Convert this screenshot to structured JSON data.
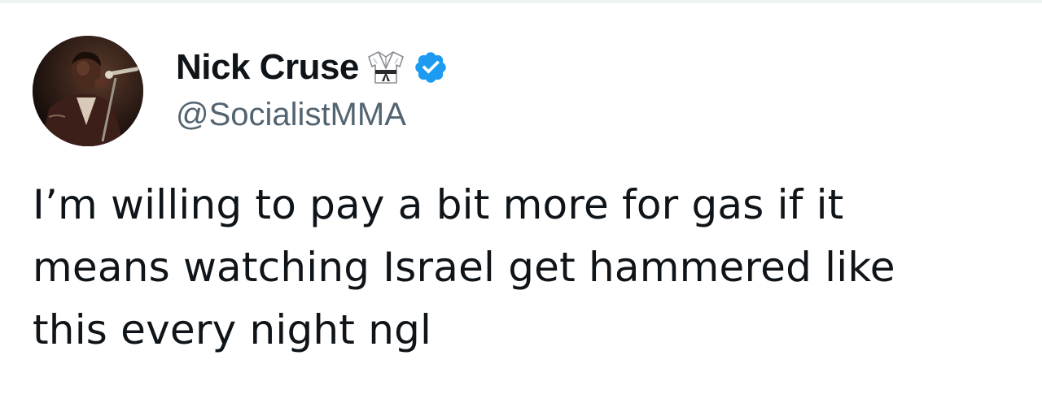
{
  "tweet": {
    "author": {
      "display_name": "Nick Cruse",
      "handle": "@SocialistMMA",
      "avatar_icon": "profile-photo-man-with-microphone",
      "name_emoji_icon": "martial-arts-uniform-icon",
      "verified_icon": "verified-badge-icon",
      "verified_color": "#1d9bf0"
    },
    "text_lines": [
      "I’m willing to pay a bit more for gas if it",
      "means watching Israel get hammered like",
      "this every night ngl"
    ]
  },
  "colors": {
    "text_primary": "#0f1419",
    "text_secondary": "#536471",
    "background": "#ffffff"
  }
}
